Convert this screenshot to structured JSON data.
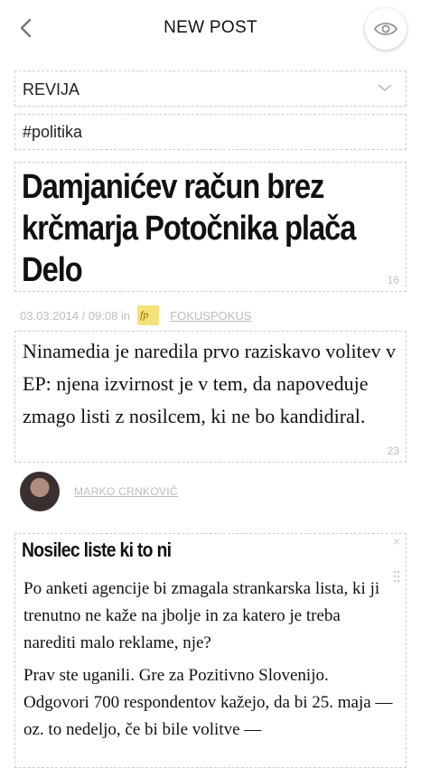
{
  "header": {
    "title": "NEW POST",
    "back_icon": "chevron-left-icon",
    "preview_icon": "eye-icon"
  },
  "category": {
    "value": "REVIJA"
  },
  "tags": {
    "value": "#politika"
  },
  "headline": {
    "text": "Damjanićev račun brez krčmarja Potočnika plača Delo",
    "char_count": "16"
  },
  "meta": {
    "date": "03.03.2014 / 09:08 in",
    "source_logo": "fp",
    "source": "FOKUSPOKUS"
  },
  "lead": {
    "text": "Ninamedia je naredila prvo raziskavo volitev v EP: njena izvirnost je v tem, da napoveduje zmago listi z nosilcem, ki ne bo kandidiral.",
    "char_count": "23"
  },
  "author": {
    "name": "MARKO CRNKOVIČ"
  },
  "body": {
    "close_glyph": "×",
    "subheading": "Nosilec liste ki to ni",
    "paragraphs": [
      "Po anketi agencije bi zmagala strankarska lista, ki ji trenutno ne kaže na jbolje in za katero je treba narediti malo reklame, nje?",
      "Prav ste uganili. Gre za Pozitivno Slovenijo. Odgovori 700 respondentov kažejo, da bi 25. maja — oz. to nedeljo, če bi bile volitve —"
    ]
  }
}
